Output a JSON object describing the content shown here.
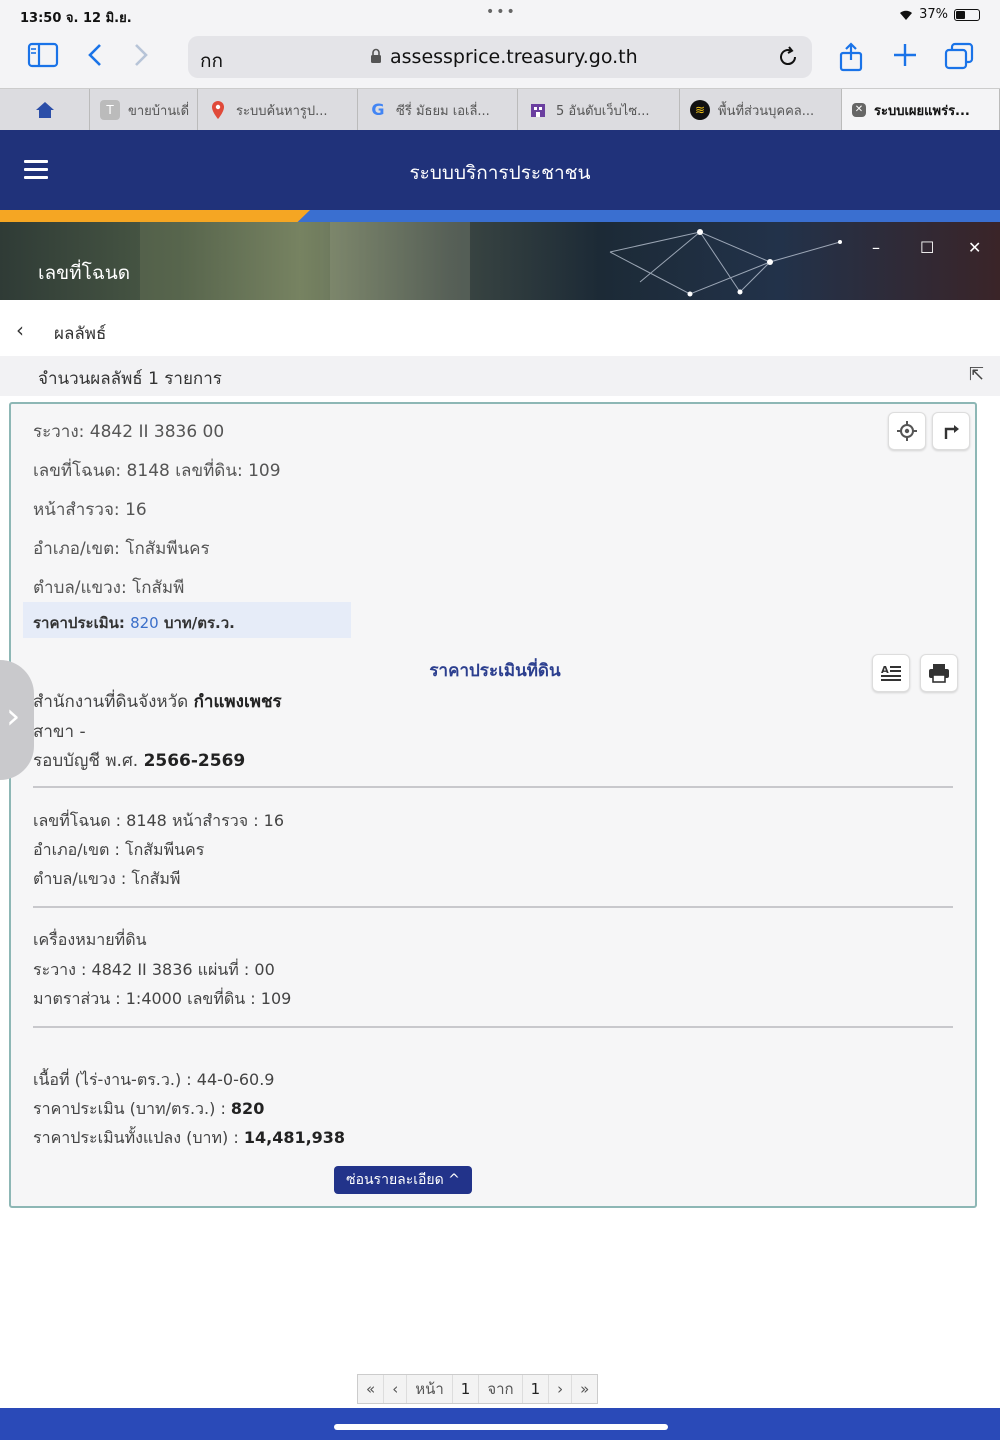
{
  "status_bar": {
    "time": "13:50  จ. 12 มิ.ย.",
    "dots": "•••",
    "battery": "37%"
  },
  "toolbar": {
    "text_size": "กก",
    "url": "assessprice.treasury.go.th"
  },
  "tabs": [
    {
      "label": "ขายบ้านเดี่",
      "icon": "generic-page-icon"
    },
    {
      "label": "ระบบค้นหารูป...",
      "icon": "map-pin-icon"
    },
    {
      "label": "ซีรี่ มัธยม เอเลี่...",
      "icon": "google-icon"
    },
    {
      "label": "5 อันดับเว็บไซ...",
      "icon": "building-icon"
    },
    {
      "label": "พื้นที่ส่วนบุคคล...",
      "icon": "logo-icon"
    },
    {
      "label": "ระบบเผยแพร่ร...",
      "icon": "close-icon"
    }
  ],
  "header": {
    "title": "ระบบบริการประชาชน"
  },
  "banner": {
    "label": "เลขที่โฉนด"
  },
  "back": {
    "label": "ผลลัพธ์"
  },
  "count": {
    "label": "จำนวนผลลัพธ์ 1 รายการ"
  },
  "summary": {
    "rawang": "ระวาง: 4842 II 3836 00",
    "deed": "เลขที่โฉนด: 8148 เลขที่ดิน: 109",
    "survey": "หน้าสำรวจ: 16",
    "district": "อำเภอ/เขต: โกสัมพีนคร",
    "subdistrict": "ตำบล/แขวง: โกสัมพี",
    "price_label": "ราคาประเมิน:",
    "price_value": "820",
    "price_unit": "บาท/ตร.ว."
  },
  "detail": {
    "title": "ราคาประเมินที่ดิน",
    "office_prefix": "สำนักงานที่ดินจังหวัด",
    "office_value": "กำแพงเพชร",
    "branch": "สาขา -",
    "period_prefix": "รอบบัญชี พ.ศ.",
    "period_value": "2566-2569",
    "deed_line": "เลขที่โฉนด : 8148 หน้าสำรวจ : 16",
    "district_line": "อำเภอ/เขต : โกสัมพีนคร",
    "subdistrict_line": "ตำบล/แขวง : โกสัมพี",
    "marker_title": "เครื่องหมายที่ดิน",
    "rawang_line": "ระวาง : 4842 II 3836 แผ่นที่ : 00",
    "scale_line": "มาตราส่วน : 1:4000 เลขที่ดิน : 109",
    "area_line": "เนื้อที่ (ไร่-งาน-ตร.ว.) : 44-0-60.9",
    "price_per_prefix": "ราคาประเมิน (บาท/ตร.ว.) :",
    "price_per_value": "820",
    "total_prefix": "ราคาประเมินทั้งแปลง (บาท) :",
    "total_value": "14,481,938",
    "hide_button": "ซ่อนรายละเอียด ^"
  },
  "pager": {
    "first": "«",
    "prev": "‹",
    "page_label": "หน้า",
    "page": "1",
    "of_label": "จาก",
    "total": "1",
    "next": "›",
    "last": "»"
  },
  "colors": {
    "header": "#20327a",
    "accent_orange": "#f5a623",
    "accent_blue": "#3a6fd0",
    "card_border": "#8db7b5",
    "price_blue": "#3b6fc9"
  }
}
